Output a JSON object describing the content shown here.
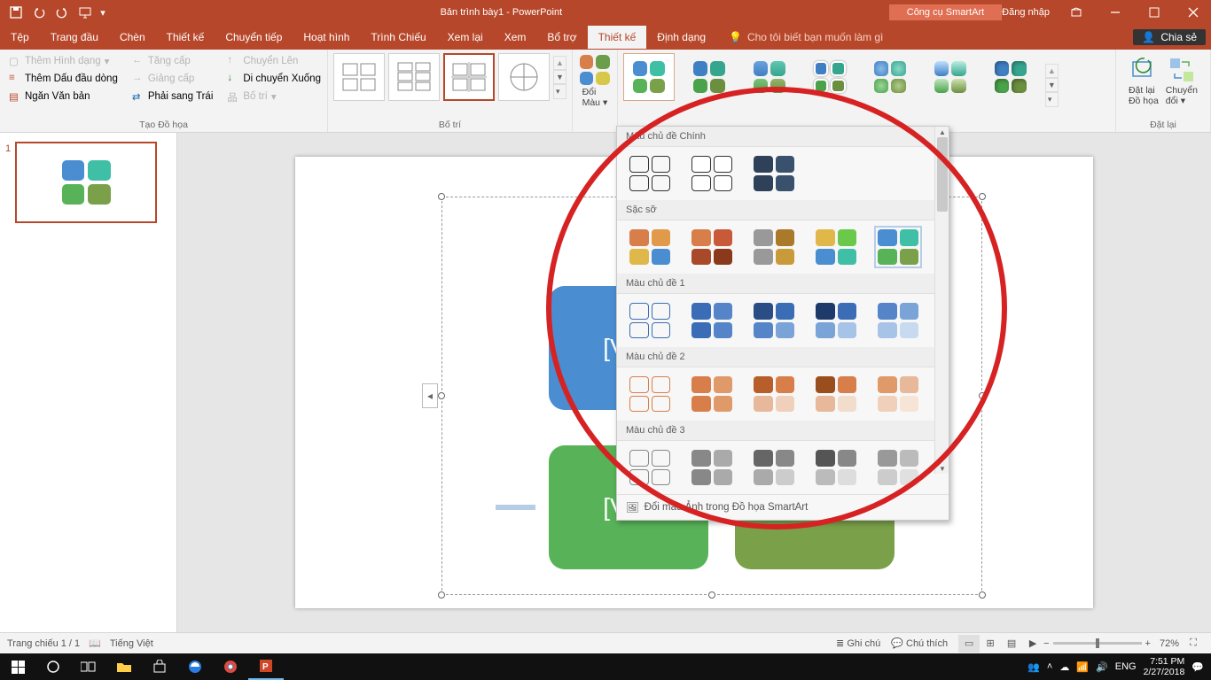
{
  "title": "Bản trình bày1  -  PowerPoint",
  "contextTab": "Công cụ SmartArt",
  "signin": "Đăng nhập",
  "tabs": [
    "Tệp",
    "Trang đầu",
    "Chèn",
    "Thiết kế",
    "Chuyển tiếp",
    "Hoạt hình",
    "Trình Chiếu",
    "Xem lại",
    "Xem",
    "Bổ trợ",
    "Thiết kế",
    "Định dạng"
  ],
  "activeTabIndex": 10,
  "tellMe": "Cho tôi biết bạn muốn làm gì",
  "shareLabel": "Chia sẻ",
  "group1": {
    "addShape": "Thêm Hình dạng",
    "addBullet": "Thêm Dấu đầu dòng",
    "textPane": "Ngăn Văn bản",
    "tangCap": "Tăng cấp",
    "giangCap": "Giảng cấp",
    "phaiSangTrai": "Phải sang Trái",
    "chuyenLen": "Chuyển Lên",
    "chuyenXuong": "Di chuyển Xuống",
    "boTri": "Bố trí",
    "label": "Tạo Đồ họa"
  },
  "layoutGroup": {
    "label": "Bố trí"
  },
  "colorBtn": {
    "line1": "Đổi",
    "line2": "Màu"
  },
  "resetGroup": {
    "reset1a": "Đặt lại",
    "reset1b": "Đồ họa",
    "reset2a": "Chuyển",
    "reset2b": "đổi",
    "label": "Đặt lại"
  },
  "thumbNum": "1",
  "shapeText1": "[Văn",
  "shapeText2": "[Văn",
  "colorMenu": {
    "s1": "Màu chủ đề Chính",
    "s2": "Sặc sỡ",
    "s3": "Màu chủ đề 1",
    "s4": "Màu chủ đề 2",
    "s5": "Màu chủ đề 3",
    "footer": "Đổi màu Ảnh trong Đồ họa SmartArt"
  },
  "status": {
    "slide": "Trang chiếu 1 / 1",
    "lang": "Tiếng Việt",
    "notes": "Ghi chú",
    "comments": "Chú thích",
    "zoom": "72%"
  },
  "taskbar": {
    "ime": "ENG",
    "time": "7:51 PM",
    "date": "2/27/2018"
  }
}
